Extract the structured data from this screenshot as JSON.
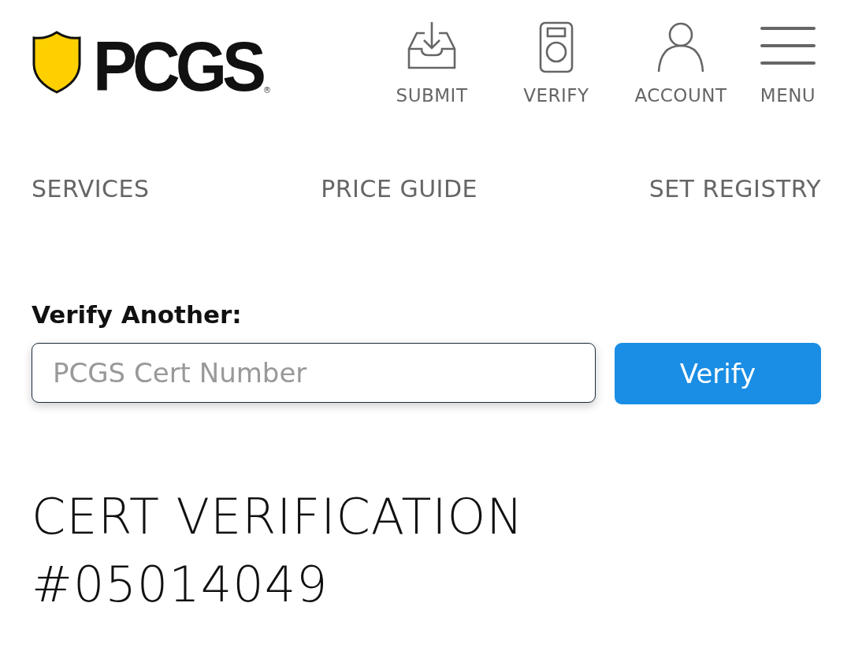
{
  "logo": {
    "text": "PCGS",
    "mark": "®"
  },
  "nav_icons": [
    {
      "kind": "submit",
      "label": "SUBMIT"
    },
    {
      "kind": "verify",
      "label": "VERIFY"
    },
    {
      "kind": "account",
      "label": "ACCOUNT"
    },
    {
      "kind": "menu",
      "label": "MENU"
    }
  ],
  "links": [
    "SERVICES",
    "PRICE GUIDE",
    "SET REGISTRY"
  ],
  "verify_form": {
    "label": "Verify Another:",
    "placeholder": "PCGS Cert Number",
    "focused": true,
    "button": "Verify"
  },
  "heading": "CERT VERIFICATION #05014049"
}
